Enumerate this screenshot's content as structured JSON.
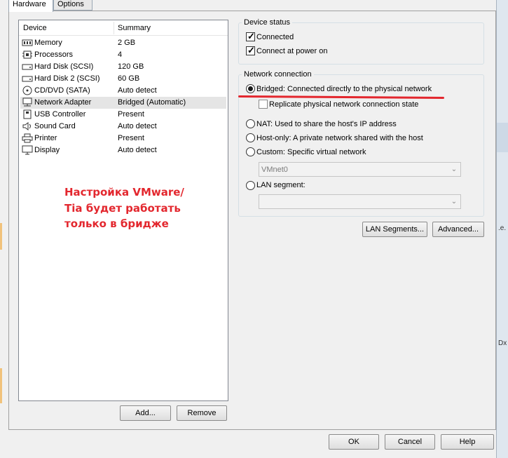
{
  "tabs": [
    "Hardware",
    "Options"
  ],
  "device_list": {
    "headers": {
      "device": "Device",
      "summary": "Summary"
    },
    "rows": [
      {
        "name": "Memory",
        "summary": "2 GB",
        "icon": "memory-icon"
      },
      {
        "name": "Processors",
        "summary": "4",
        "icon": "processor-icon"
      },
      {
        "name": "Hard Disk (SCSI)",
        "summary": "120 GB",
        "icon": "hard-disk-icon"
      },
      {
        "name": "Hard Disk 2 (SCSI)",
        "summary": "60 GB",
        "icon": "hard-disk-icon"
      },
      {
        "name": "CD/DVD (SATA)",
        "summary": "Auto detect",
        "icon": "cd-dvd-icon"
      },
      {
        "name": "Network Adapter",
        "summary": "Bridged (Automatic)",
        "icon": "network-adapter-icon"
      },
      {
        "name": "USB Controller",
        "summary": "Present",
        "icon": "usb-icon"
      },
      {
        "name": "Sound Card",
        "summary": "Auto detect",
        "icon": "speaker-icon"
      },
      {
        "name": "Printer",
        "summary": "Present",
        "icon": "printer-icon"
      },
      {
        "name": "Display",
        "summary": "Auto detect",
        "icon": "monitor-icon"
      }
    ],
    "selected": "Network Adapter"
  },
  "annotation": {
    "line1": "Настройка VMware/",
    "line2": "Tia будет работать",
    "line3": "только в бридже",
    "color": "#e3272e"
  },
  "list_buttons": {
    "add": "Add...",
    "remove": "Remove"
  },
  "device_status": {
    "legend": "Device status",
    "connected": "Connected",
    "connect_power": "Connect at power on"
  },
  "network_connection": {
    "legend": "Network connection",
    "bridged": "Bridged: Connected directly to the physical network",
    "replicate": "Replicate physical network connection state",
    "nat": "NAT: Used to share the host's IP address",
    "host_only": "Host-only: A private network shared with the host",
    "custom": "Custom: Specific virtual network",
    "vmnet_value": "VMnet0",
    "lan_segment": "LAN segment:",
    "lan_segment_value": "",
    "selected": "bridged"
  },
  "buttons": {
    "lan_segments": "LAN Segments...",
    "advanced": "Advanced...",
    "ok": "OK",
    "cancel": "Cancel",
    "help": "Help"
  },
  "right_fragments": [
    ".e.",
    "Dx"
  ]
}
